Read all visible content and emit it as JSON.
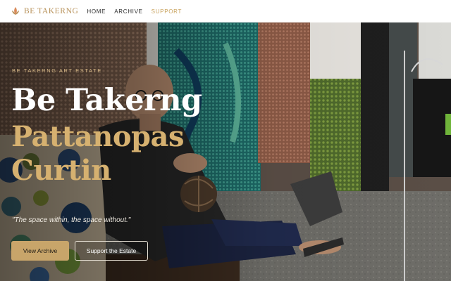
{
  "nav": {
    "brand": "BE TAKERNG",
    "links": [
      {
        "label": "HOME"
      },
      {
        "label": "ARCHIVE"
      },
      {
        "label": "SUPPORT"
      }
    ],
    "active_link": "SUPPORT",
    "brand_color": "#b8925a",
    "active_color": "#c9a35e"
  },
  "hero": {
    "eyebrow": "BE TAKERNG ART ESTATE",
    "title_line1": "Be Takerng",
    "title_line2": "Pattanopas",
    "title_line3": "Curtin",
    "quote": "\"The space within, the space without.\"",
    "primary_button": "View Archive",
    "secondary_button": "Support the Estate",
    "accent_color": "#d6b170"
  }
}
